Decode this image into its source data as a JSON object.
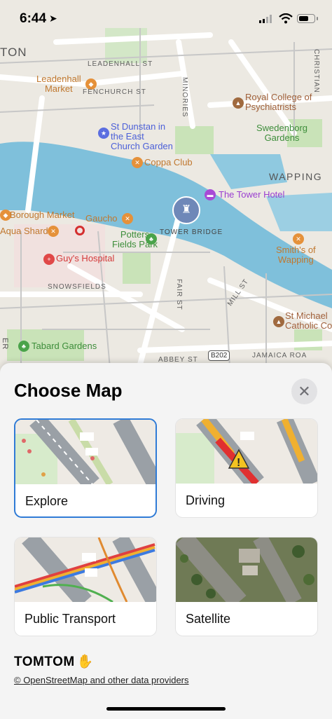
{
  "status_bar": {
    "time": "6:44"
  },
  "map": {
    "labels": {
      "leadenhall": "Leadenhall\nMarket",
      "fenchurch": "FENCHURCH ST",
      "leadenhall_st": "LEADENHALL ST",
      "minories": "MINORIES",
      "royal_college": "Royal College of\nPsychiatrists",
      "christian": "CHRISTIAN",
      "st_dunstan": "St Dunstan in\nthe East\nChurch Garden",
      "swedenborg": "Swedenborg\nGardens",
      "coppa": "Coppa Club",
      "wapping": "WAPPING",
      "tower_hotel": "The Tower Hotel",
      "borough": "Borough Market",
      "gaucho": "Gaucho",
      "aqua": "Aqua Shard",
      "tower_bridge": "TOWER BRIDGE",
      "potters": "Potters\nFields Park",
      "smiths": "Smith's of\nWapping",
      "guys": "Guy's Hospital",
      "snowsfields": "SNOWSFIELDS",
      "fair_st": "FAIR ST",
      "mill_st": "MILL ST",
      "st_michael": "St Michael\nCatholic Co",
      "tabard": "Tabard Gardens",
      "abbey": "ABBEY ST",
      "b202": "B202",
      "jamaica": "JAMAICA ROA",
      "ton": "TON",
      "er": "ER"
    }
  },
  "sheet": {
    "title": "Choose Map",
    "options": [
      {
        "label": "Explore",
        "selected": true
      },
      {
        "label": "Driving",
        "selected": false
      },
      {
        "label": "Public Transport",
        "selected": false
      },
      {
        "label": "Satellite",
        "selected": false
      }
    ],
    "logo": "TOMTOM",
    "attribution": "© OpenStreetMap and other data providers"
  },
  "colors": {
    "accent": "#2f7bd6",
    "river": "#7fc0db",
    "park": "#b6dca0"
  }
}
